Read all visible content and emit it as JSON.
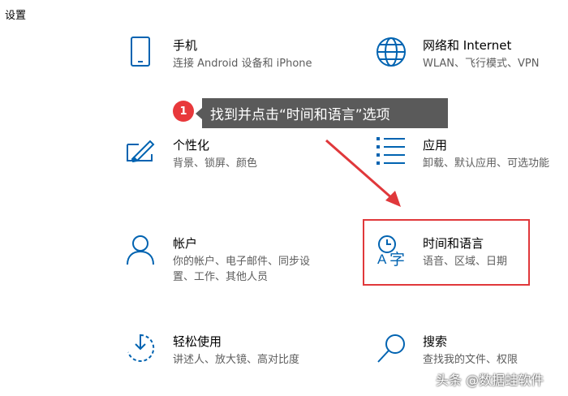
{
  "window": {
    "title": "设置"
  },
  "tiles": [
    {
      "name": "手机",
      "desc": "连接 Android 设备和 iPhone",
      "icon": "phone-icon"
    },
    {
      "name": "网络和 Internet",
      "desc": "WLAN、飞行模式、VPN",
      "icon": "globe-icon"
    },
    {
      "name": "个性化",
      "desc": "背景、锁屏、颜色",
      "icon": "personalization-icon"
    },
    {
      "name": "应用",
      "desc": "卸载、默认应用、可选功能",
      "icon": "apps-list-icon"
    },
    {
      "name": "帐户",
      "desc": "你的帐户、电子邮件、同步设置、工作、其他人员",
      "icon": "account-icon"
    },
    {
      "name": "时间和语言",
      "desc": "语音、区域、日期",
      "icon": "time-language-icon"
    },
    {
      "name": "轻松使用",
      "desc": "讲述人、放大镜、高对比度",
      "icon": "ease-of-access-icon"
    },
    {
      "name": "搜索",
      "desc": "查找我的文件、权限",
      "icon": "search-icon"
    }
  ],
  "annotation": {
    "step_number": "1",
    "text": "找到并点击“时间和语言”选项",
    "accent_color": "#e8383b"
  },
  "watermark": "头条 @数据蛙软件",
  "colors": {
    "icon_blue": "#0063b1",
    "tooltip_bg": "#5a5a5a"
  }
}
